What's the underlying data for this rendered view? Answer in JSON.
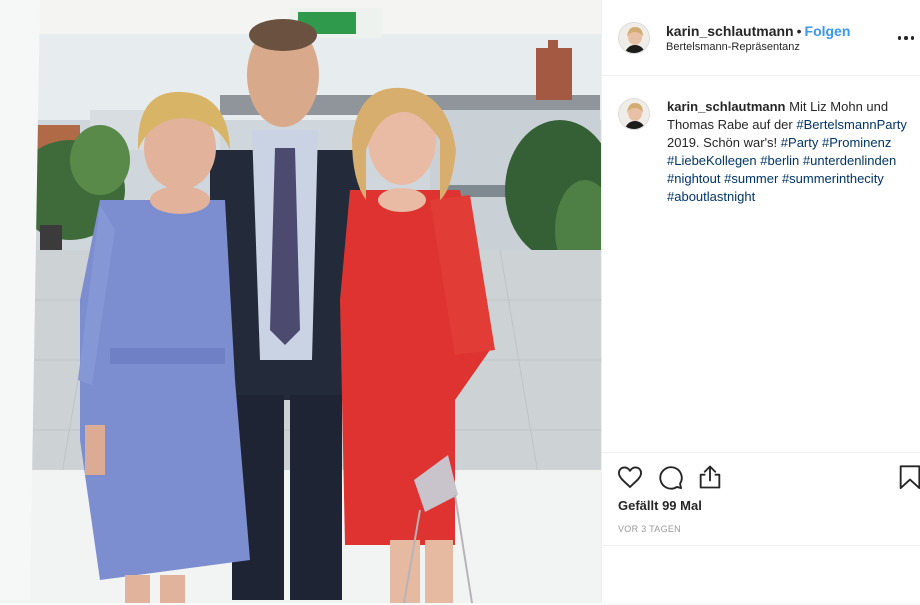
{
  "post": {
    "username": "karin_schlautmann",
    "separator": "•",
    "follow_label": "Folgen",
    "location": "Bertelsmann-Repräsentanz",
    "photo_icon": "event-photo-three-people",
    "caption": {
      "username": "karin_schlautmann",
      "text_1": "Mit Liz Mohn und Thomas Rabe auf der",
      "hashtag_party": "#BertelsmannParty",
      "text_2": "2019. Schön war's!",
      "hashtags": [
        "#Party",
        "#Prominenz",
        "#LiebeKollegen",
        "#berlin",
        "#unterdenlinden",
        "#nightout",
        "#summer",
        "#summerinthecity",
        "#aboutlastnight"
      ]
    },
    "actions": {
      "like_icon": "heart-icon",
      "comment_icon": "comment-icon",
      "share_icon": "share-icon",
      "save_icon": "bookmark-icon"
    },
    "likes_text": "Gefällt 99 Mal",
    "time_text": "VOR 3 TAGEN"
  },
  "colors": {
    "link_blue": "#3897f0",
    "hashtag": "#003569",
    "text": "#262626",
    "muted": "#999999",
    "border": "#efefef"
  }
}
